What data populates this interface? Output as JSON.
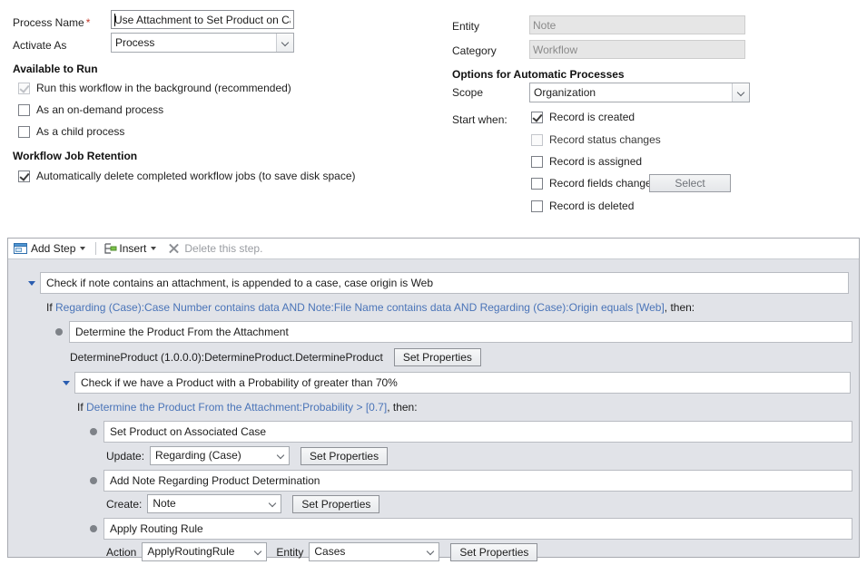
{
  "form": {
    "process_name_label": "Process Name",
    "process_name_required": "*",
    "process_name_value": "Use Attachment to Set Product on Cas",
    "activate_as_label": "Activate As",
    "activate_as_value": "Process",
    "available_to_run_heading": "Available to Run",
    "available_to_run": [
      {
        "label": "Run this workflow in the background (recommended)",
        "checked": true,
        "disabled": true
      },
      {
        "label": "As an on-demand process",
        "checked": false,
        "disabled": false
      },
      {
        "label": "As a child process",
        "checked": false,
        "disabled": false
      }
    ],
    "job_retention_heading": "Workflow Job Retention",
    "job_retention": [
      {
        "label": "Automatically delete completed workflow jobs (to save disk space)",
        "checked": true,
        "disabled": false
      }
    ],
    "entity_label": "Entity",
    "entity_value": "Note",
    "category_label": "Category",
    "category_value": "Workflow",
    "options_heading": "Options for Automatic Processes",
    "scope_label": "Scope",
    "scope_value": "Organization",
    "start_when_label": "Start when:",
    "start_when": [
      {
        "label": "Record is created",
        "checked": true,
        "disabled": false
      },
      {
        "label": "Record status changes",
        "checked": false,
        "disabled": true
      },
      {
        "label": "Record is assigned",
        "checked": false,
        "disabled": false
      },
      {
        "label": "Record fields change",
        "checked": false,
        "disabled": false
      },
      {
        "label": "Record is deleted",
        "checked": false,
        "disabled": false
      }
    ],
    "select_button_label": "Select"
  },
  "toolbar": {
    "add_step_label": "Add Step",
    "insert_label": "Insert",
    "delete_label": "Delete this step."
  },
  "steps": {
    "step1_title": "Check if note contains an attachment, is appended to a case, case origin is Web",
    "step1_if_prefix": "If",
    "step1_condition": "Regarding (Case):Case Number contains data AND Note:File Name contains data AND Regarding (Case):Origin equals [Web]",
    "step1_then": ", then:",
    "step2_title": "Determine the Product From the Attachment",
    "step2_detail": "DetermineProduct (1.0.0.0):DetermineProduct.DetermineProduct",
    "step2_button": "Set Properties",
    "step3_title": "Check if we have a Product with a Probability of greater than 70%",
    "step3_if_prefix": "If",
    "step3_condition": "Determine the Product From the Attachment:Probability > [0.7]",
    "step3_then": ", then:",
    "step4_title": "Set Product on Associated Case",
    "step4_label": "Update:",
    "step4_value": "Regarding (Case)",
    "step4_button": "Set Properties",
    "step5_title": "Add Note Regarding Product Determination",
    "step5_label": "Create:",
    "step5_value": "Note",
    "step5_button": "Set Properties",
    "step6_title": "Apply Routing Rule",
    "step6_action_label": "Action",
    "step6_action_value": "ApplyRoutingRule",
    "step6_entity_label": "Entity",
    "step6_entity_value": "Cases",
    "step6_button": "Set Properties"
  },
  "colors": {
    "link": "#4a74b8",
    "panel_bg": "#e1e3e8",
    "required": "#c0392b"
  }
}
